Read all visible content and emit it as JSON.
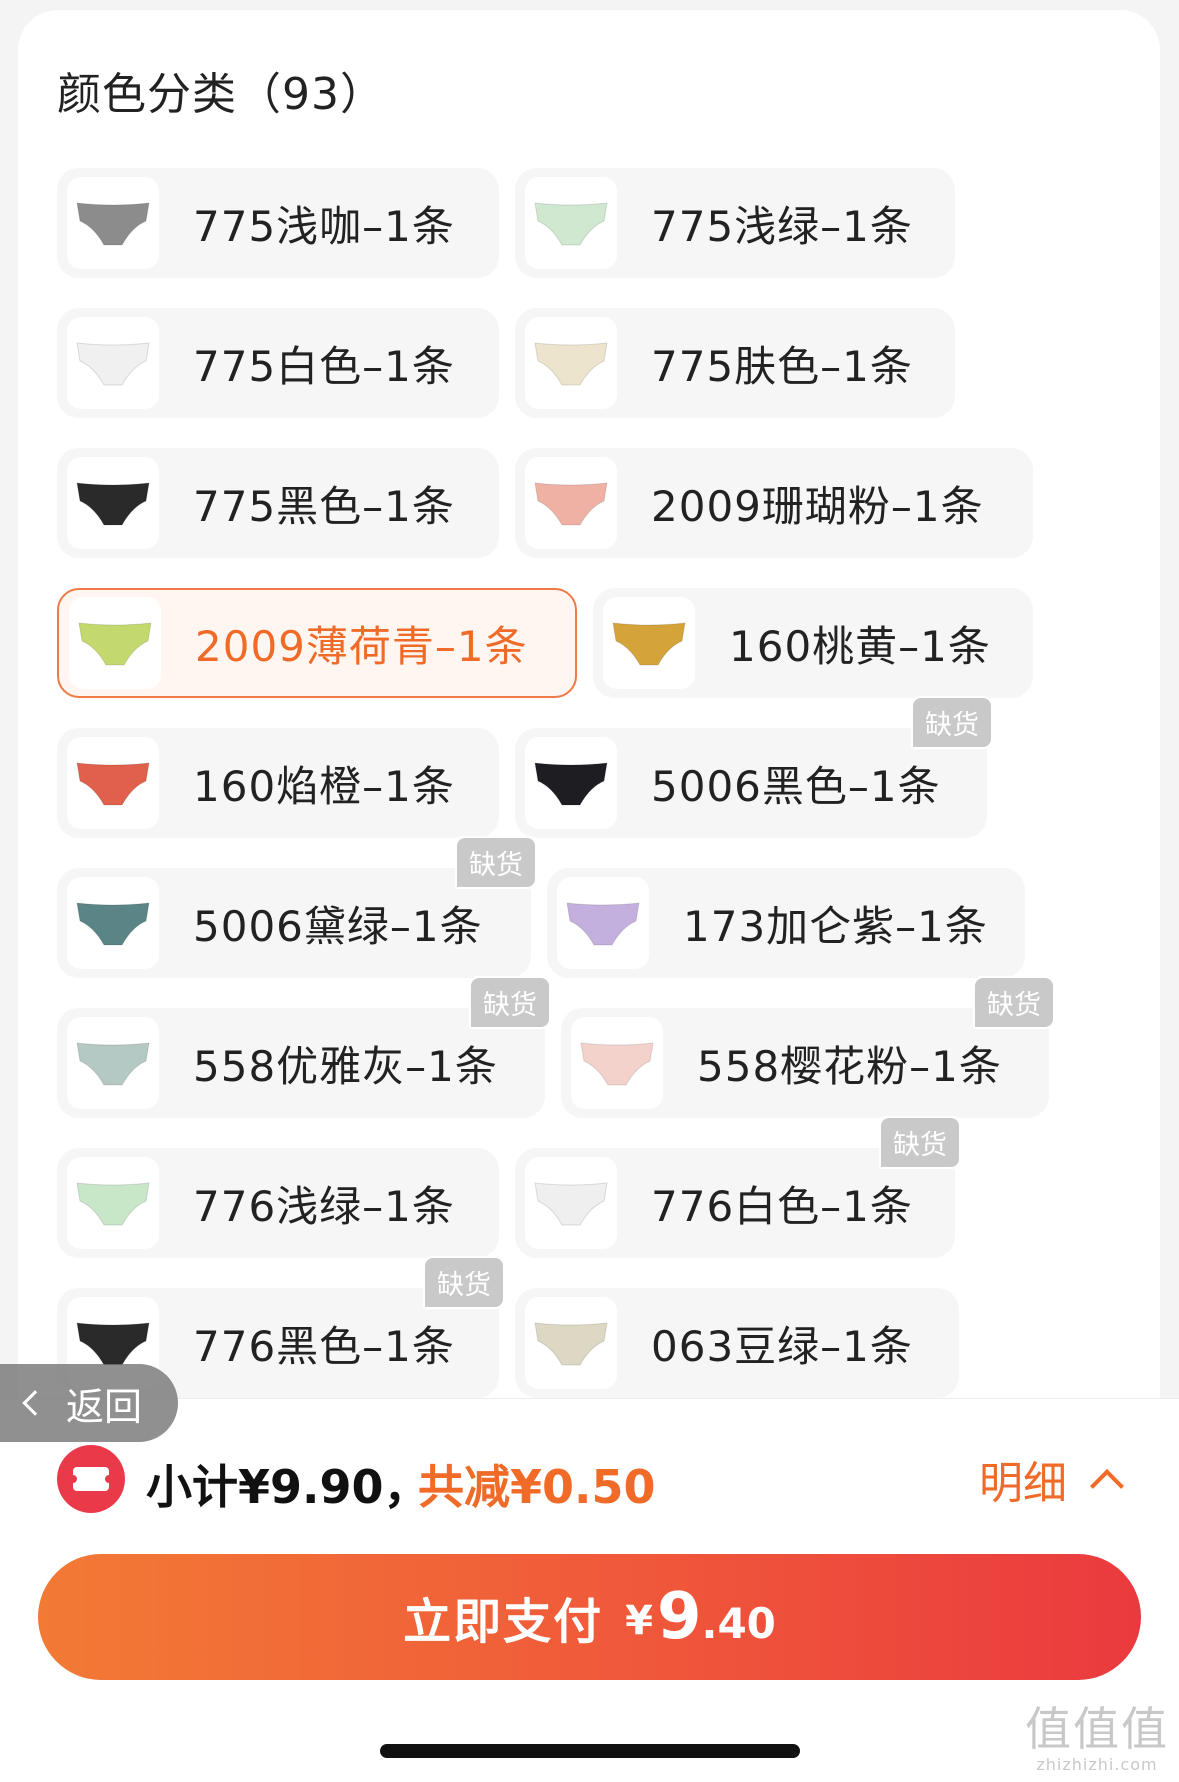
{
  "header": {
    "title": "颜色分类（93）"
  },
  "skus": [
    {
      "label": "775浅咖–1条",
      "color": "#8c8c8c",
      "out_of_stock": false,
      "selected": false
    },
    {
      "label": "775浅绿–1条",
      "color": "#cfe8cf",
      "out_of_stock": false,
      "selected": false
    },
    {
      "label": "775白色–1条",
      "color": "#f0f0f0",
      "out_of_stock": false,
      "selected": false
    },
    {
      "label": "775肤色–1条",
      "color": "#ece4cc",
      "out_of_stock": false,
      "selected": false
    },
    {
      "label": "775黑色–1条",
      "color": "#2a2a2a",
      "out_of_stock": false,
      "selected": false
    },
    {
      "label": "2009珊瑚粉–1条",
      "color": "#eeb1a4",
      "out_of_stock": false,
      "selected": false
    },
    {
      "label": "2009薄荷青–1条",
      "color": "#c4d96d",
      "out_of_stock": false,
      "selected": true
    },
    {
      "label": "160桃黄–1条",
      "color": "#d4a43a",
      "out_of_stock": false,
      "selected": false
    },
    {
      "label": "160焰橙–1条",
      "color": "#e0604c",
      "out_of_stock": false,
      "selected": false
    },
    {
      "label": "5006黑色–1条",
      "color": "#1e1e22",
      "out_of_stock": true,
      "selected": false
    },
    {
      "label": "5006黛绿–1条",
      "color": "#5a8485",
      "out_of_stock": true,
      "selected": false
    },
    {
      "label": "173加仑紫–1条",
      "color": "#c4b0de",
      "out_of_stock": false,
      "selected": false
    },
    {
      "label": "558优雅灰–1条",
      "color": "#b4c8c4",
      "out_of_stock": true,
      "selected": false
    },
    {
      "label": "558樱花粉–1条",
      "color": "#f4d2cc",
      "out_of_stock": true,
      "selected": false
    },
    {
      "label": "776浅绿–1条",
      "color": "#c8e6c8",
      "out_of_stock": false,
      "selected": false
    },
    {
      "label": "776白色–1条",
      "color": "#efefef",
      "out_of_stock": true,
      "selected": false
    },
    {
      "label": "776黑色–1条",
      "color": "#2a2a2a",
      "out_of_stock": true,
      "selected": false
    },
    {
      "label": "063豆绿–1条",
      "color": "#dcd8c4",
      "out_of_stock": false,
      "selected": false
    }
  ],
  "badges": {
    "out_of_stock": "缺货"
  },
  "back": {
    "label": "返回"
  },
  "summary": {
    "subtotal": "小计¥9.90，",
    "discount": "共减¥0.50",
    "detail_label": "明细"
  },
  "pay": {
    "label": "立即支付",
    "currency": "¥",
    "amount_int": "9",
    "amount_dec": ".40"
  },
  "watermark": {
    "top": "值值值",
    "bottom": "zhizhizhi.com"
  },
  "colors": {
    "accent": "#f06a28",
    "selected_border": "#f07a45",
    "pay_gradient_start": "#f27a35",
    "pay_gradient_end": "#ea3a3f",
    "badge_bg": "#c9c9c9",
    "coupon_red": "#ea3a4a"
  }
}
